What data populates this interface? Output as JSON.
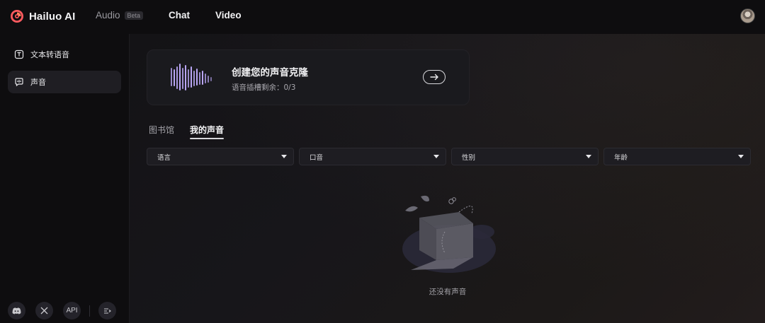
{
  "brand": {
    "name": "Hailuo AI"
  },
  "nav": {
    "audio": "Audio",
    "audio_badge": "Beta",
    "chat": "Chat",
    "video": "Video"
  },
  "sidebar": {
    "items": [
      {
        "label": "文本转语音",
        "icon": "text-to-speech-icon",
        "active": false
      },
      {
        "label": "声音",
        "icon": "voice-icon",
        "active": true
      }
    ],
    "bottom": [
      {
        "icon": "discord-icon"
      },
      {
        "icon": "x-icon"
      },
      {
        "label": "API",
        "icon": "api-icon"
      },
      {
        "icon": "collapse-sidebar-icon"
      }
    ]
  },
  "clone_card": {
    "title": "创建您的声音克隆",
    "subtitle": "语音插槽剩余：0/3"
  },
  "tabs": [
    {
      "label": "图书馆",
      "active": false
    },
    {
      "label": "我的声音",
      "active": true
    }
  ],
  "filters": [
    {
      "label": "语言"
    },
    {
      "label": "口音"
    },
    {
      "label": "性别"
    },
    {
      "label": "年龄"
    }
  ],
  "empty_state": {
    "text": "还没有声音"
  },
  "colors": {
    "background": "#0e0d0f",
    "card": "#1a1a1e",
    "accent_wave": "#b9a6f5",
    "logo_accent": "#ff5a5f"
  }
}
